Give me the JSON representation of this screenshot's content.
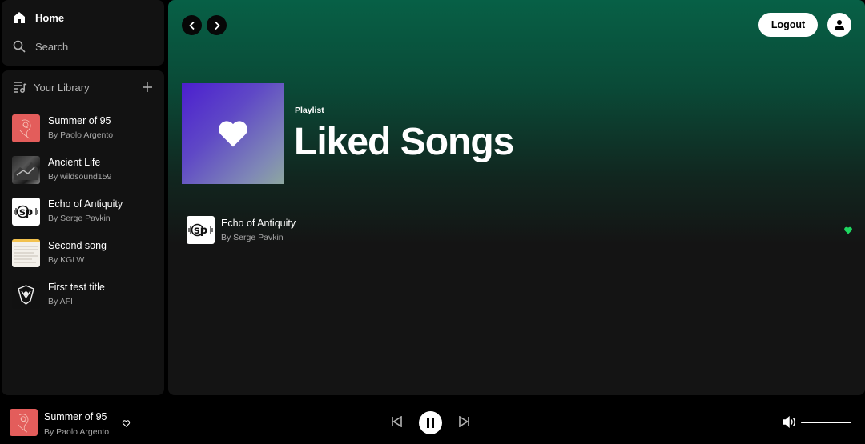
{
  "nav": {
    "home": "Home",
    "search": "Search"
  },
  "library": {
    "title": "Your Library",
    "items": [
      {
        "title": "Summer of 95",
        "artist": "By Paolo Argento",
        "thumb": "red-sketch"
      },
      {
        "title": "Ancient Life",
        "artist": "By wildsound159",
        "thumb": "dark-photo"
      },
      {
        "title": "Echo of Antiquity",
        "artist": "By Serge Pavkin",
        "thumb": "sp-logo"
      },
      {
        "title": "Second song",
        "artist": "By KGLW",
        "thumb": "document"
      },
      {
        "title": "First test title",
        "artist": "By AFI",
        "thumb": "afi-logo"
      }
    ]
  },
  "header": {
    "logout_label": "Logout"
  },
  "playlist": {
    "type": "Playlist",
    "title": "Liked Songs",
    "tracks": [
      {
        "title": "Echo of Antiquity",
        "artist": "By Serge Pavkin",
        "liked": true
      }
    ]
  },
  "player": {
    "title": "Summer of 95",
    "artist": "By Paolo Argento",
    "state": "playing",
    "volume": 1.0
  },
  "colors": {
    "accent": "#1ed760",
    "background": "#000000",
    "panel": "#121212",
    "header_gradient": "#076046",
    "cover_gradient_start": "#4b1fcf"
  }
}
